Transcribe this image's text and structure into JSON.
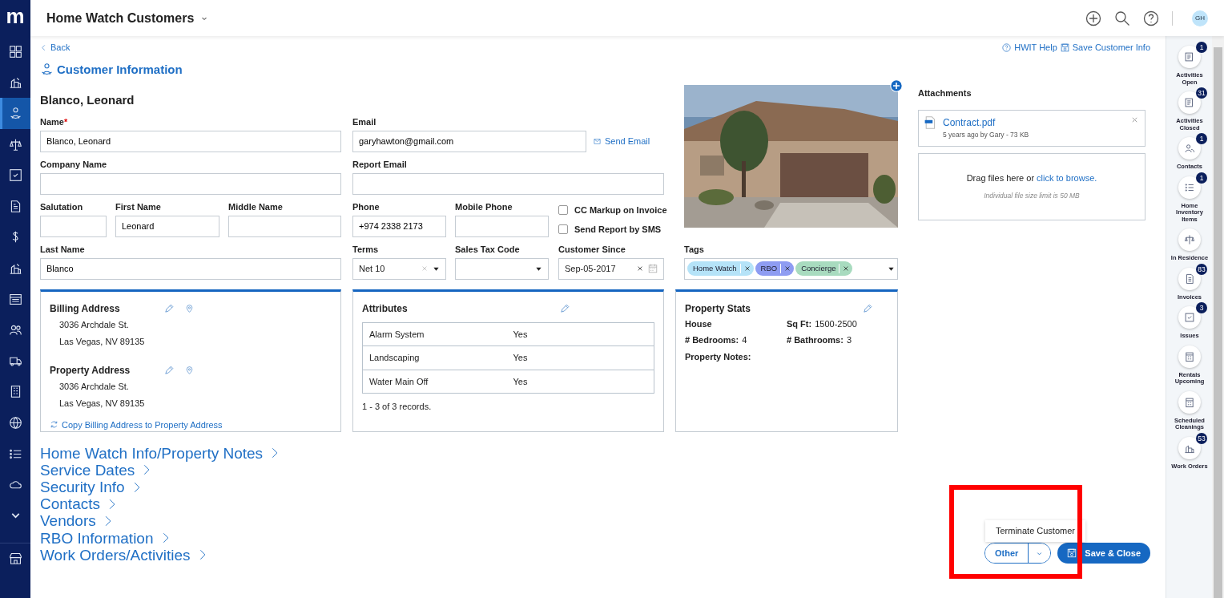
{
  "app": {
    "logo": "m"
  },
  "header": {
    "title": "Home Watch Customers",
    "avatar": "GH"
  },
  "sidebar": {
    "items": [
      {
        "selected": false
      },
      {
        "selected": false
      },
      {
        "selected": true
      },
      {
        "selected": false
      },
      {
        "selected": false
      },
      {
        "selected": false
      },
      {
        "selected": false
      },
      {
        "selected": false
      },
      {
        "selected": false
      },
      {
        "selected": false
      },
      {
        "selected": false
      },
      {
        "selected": false
      },
      {
        "selected": false
      },
      {
        "selected": false
      },
      {
        "selected": false
      },
      {
        "selected": false
      },
      {
        "selected": false
      }
    ]
  },
  "back": "Back",
  "page_title": "Customer Information",
  "top_links": [
    "HWIT Help",
    "Save Customer Info"
  ],
  "customer_name": "Blanco, Leonard",
  "fields": [
    {
      "label": "Name",
      "required_mark": "*",
      "value": "Blanco, Leonard",
      "kind": "text"
    },
    {
      "label": "Email",
      "value": "garyhawton@gmail.com",
      "kind": "text",
      "action": "Send Email"
    },
    {
      "label": "Company Name",
      "kind": "text"
    },
    {
      "label": "Report Email",
      "kind": "text"
    },
    {
      "label": "Salutation",
      "kind": "text"
    },
    {
      "label": "First Name",
      "value": "Leonard",
      "kind": "text"
    },
    {
      "label": "Middle Name",
      "kind": "text"
    },
    {
      "label": "Phone",
      "value": "+974 2338 2173",
      "kind": "text"
    },
    {
      "label": "Mobile Phone",
      "kind": "text"
    },
    {
      "label": "Last Name",
      "value": "Blanco",
      "kind": "text"
    },
    {
      "label": "Terms",
      "value": "Net 10",
      "kind": "select"
    },
    {
      "label": "Sales Tax Code",
      "kind": "select"
    },
    {
      "label": "Customer Since",
      "value": "Sep-05-2017",
      "kind": "date"
    }
  ],
  "options": [
    {
      "label": "CC Markup on Invoice",
      "checked": false
    },
    {
      "label": "Send Report by SMS",
      "checked": false
    }
  ],
  "tags": {
    "label": "Tags",
    "items": [
      {
        "label": "Home Watch",
        "color": "#b5e3f8"
      },
      {
        "label": "RBO",
        "color": "#8e9cf2"
      },
      {
        "label": "Concierge",
        "color": "#a8dbbf"
      }
    ]
  },
  "address_card": {
    "addresses": [
      {
        "title": "Billing Address",
        "lines": [
          "3036 Archdale St.",
          "Las Vegas, NV 89135"
        ]
      },
      {
        "title": "Property Address",
        "lines": [
          "3036 Archdale St.",
          "Las Vegas, NV 89135"
        ]
      }
    ],
    "copy_link": "Copy Billing Address to Property Address"
  },
  "attributes_card": {
    "title": "Attributes",
    "rows": [
      {
        "name": "Alarm System",
        "value": "Yes"
      },
      {
        "name": "Landscaping",
        "value": "Yes"
      },
      {
        "name": "Water Main Off",
        "value": "Yes"
      }
    ],
    "footer": "1 - 3 of 3 records."
  },
  "stats_card": {
    "title": "Property Stats",
    "type": "House",
    "sq_ft_label": "Sq Ft:",
    "sq_ft": "1500-2500",
    "bedrooms_label": "# Bedrooms:",
    "bedrooms": "4",
    "bathrooms_label": "# Bathrooms:",
    "bathrooms": "3",
    "notes_label": "Property Notes:"
  },
  "sections": [
    "Home Watch Info/Property Notes",
    "Service Dates",
    "Security Info",
    "Contacts",
    "Vendors",
    "RBO Information",
    "Work Orders/Activities"
  ],
  "attachments": {
    "title": "Attachments",
    "files": [
      {
        "name": "Contract.pdf",
        "meta": "5 years ago by Gary - 73 KB"
      }
    ],
    "drop_text": "Drag files here or ",
    "drop_link": "click to browse.",
    "drop_note": "Individual file size limit is 50 MB"
  },
  "rail": [
    {
      "label": "Activities Open",
      "badge": "1"
    },
    {
      "label": "Activities Closed",
      "badge": "31"
    },
    {
      "label": "Contacts",
      "badge": "1"
    },
    {
      "label": "Home Inventory Items",
      "badge": "1"
    },
    {
      "label": "In Residence"
    },
    {
      "label": "Invoices",
      "badge": "83"
    },
    {
      "label": "Issues",
      "badge": "3"
    },
    {
      "label": "Rentals Upcoming"
    },
    {
      "label": "Scheduled Cleanings"
    },
    {
      "label": "Work Orders",
      "badge": "53"
    }
  ],
  "actions": {
    "menu_items": [
      "Terminate Customer"
    ],
    "other": "Other",
    "save": "Save & Close"
  }
}
